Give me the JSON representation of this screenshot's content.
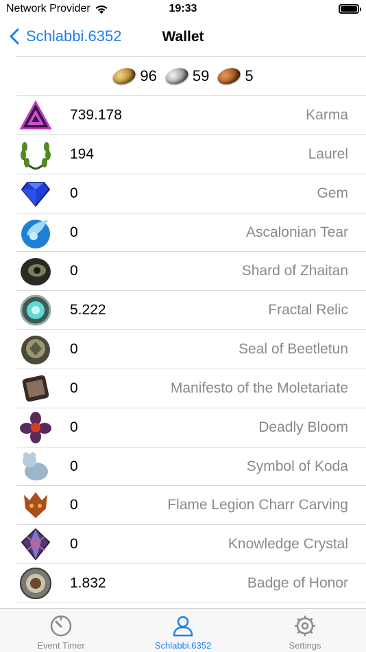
{
  "status": {
    "carrier": "Network Provider",
    "time": "19:33"
  },
  "nav": {
    "back_label": "Schlabbi.6352",
    "title": "Wallet"
  },
  "coins": {
    "gold": "96",
    "silver": "59",
    "copper": "5"
  },
  "currencies": [
    {
      "value": "739.178",
      "label": "Karma",
      "icon": "karma-icon"
    },
    {
      "value": "194",
      "label": "Laurel",
      "icon": "laurel-icon"
    },
    {
      "value": "0",
      "label": "Gem",
      "icon": "gem-icon"
    },
    {
      "value": "0",
      "label": "Ascalonian Tear",
      "icon": "ascalonian-tear-icon"
    },
    {
      "value": "0",
      "label": "Shard of Zhaitan",
      "icon": "shard-of-zhaitan-icon"
    },
    {
      "value": "5.222",
      "label": "Fractal Relic",
      "icon": "fractal-relic-icon"
    },
    {
      "value": "0",
      "label": "Seal of Beetletun",
      "icon": "seal-of-beetletun-icon"
    },
    {
      "value": "0",
      "label": "Manifesto of the Moletariate",
      "icon": "manifesto-icon"
    },
    {
      "value": "0",
      "label": "Deadly Bloom",
      "icon": "deadly-bloom-icon"
    },
    {
      "value": "0",
      "label": "Symbol of Koda",
      "icon": "symbol-of-koda-icon"
    },
    {
      "value": "0",
      "label": "Flame Legion Charr Carving",
      "icon": "charr-carving-icon"
    },
    {
      "value": "0",
      "label": "Knowledge Crystal",
      "icon": "knowledge-crystal-icon"
    },
    {
      "value": "1.832",
      "label": "Badge of Honor",
      "icon": "badge-of-honor-icon"
    }
  ],
  "tabs": [
    {
      "label": "Event Timer",
      "icon": "timer-icon"
    },
    {
      "label": "Schlabbi.6352",
      "icon": "person-icon"
    },
    {
      "label": "Settings",
      "icon": "gear-icon"
    }
  ],
  "colors": {
    "accent": "#1a7ff0",
    "secondary_text": "#8a8a8e",
    "separator": "#d8d8dc"
  }
}
